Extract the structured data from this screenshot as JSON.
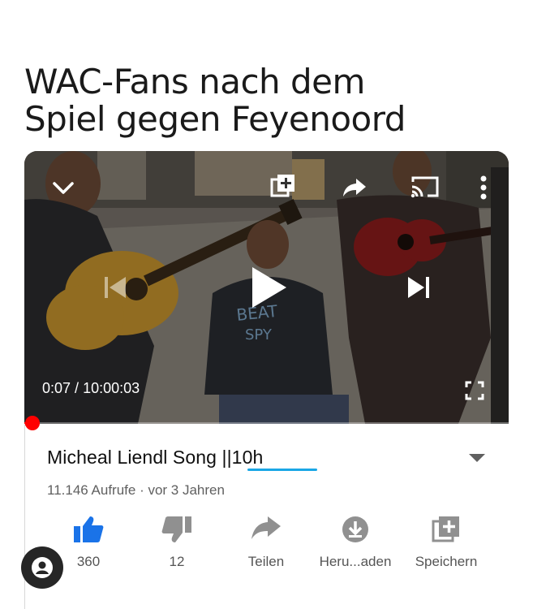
{
  "meme": {
    "title_line1": "WAC-Fans nach dem",
    "title_line2": "Spiel gegen Feyenoord"
  },
  "player": {
    "current_time": "0:07",
    "separator": " / ",
    "duration": "10:00:03",
    "progress_fraction": 0.0012,
    "accent_color": "#ff0000",
    "icons": [
      "chevron-down-icon",
      "add-to-queue-icon",
      "share-icon",
      "cast-icon",
      "more-vert-icon",
      "previous-icon",
      "play-icon",
      "next-icon",
      "fullscreen-icon"
    ]
  },
  "video": {
    "title": "Micheal Liendl Song ||10h",
    "views": "11.146 Aufrufe",
    "dot": " · ",
    "age": "vor 3 Jahren"
  },
  "actions": {
    "like": {
      "label": "360",
      "icon": "thumbs-up-icon",
      "color": "#1a73e8"
    },
    "dislike": {
      "label": "12",
      "icon": "thumbs-down-icon"
    },
    "share": {
      "label": "Teilen",
      "icon": "share-icon"
    },
    "download": {
      "label": "Heru...aden",
      "icon": "download-icon"
    },
    "save": {
      "label": "Speichern",
      "icon": "add-to-playlist-icon"
    }
  },
  "annotation": {
    "underline_color": "#1aa7e6"
  },
  "avatar": {
    "icon": "account-icon"
  }
}
